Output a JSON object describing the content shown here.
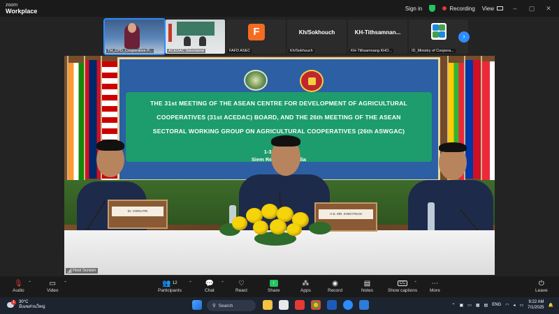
{
  "app": {
    "logo_line1": "zoom",
    "logo_line2": "Workplace"
  },
  "titlebar": {
    "signin": "Sign in",
    "recording": "Recording",
    "view": "View"
  },
  "thumbnails": [
    {
      "name": "TH_CPD_Cooperative P...",
      "type": "video"
    },
    {
      "name": "ACEDAC Sekretariat",
      "type": "video"
    },
    {
      "name": "FAFD ASEC",
      "type": "avatar",
      "initial": "F"
    },
    {
      "name": "Kh/Sokhouch",
      "type": "name",
      "display": "Kh/Sokhouch"
    },
    {
      "name": "KH-Tithsamnang KHO...",
      "type": "name",
      "display": "KH-Tithsamnan..."
    },
    {
      "name": "ID_Ministry of Coopera...",
      "type": "logo"
    }
  ],
  "stage": {
    "banner_line1": "THE 31st MEETING OF THE ASEAN CENTRE FOR DEVELOPMENT OF AGRICULTURAL",
    "banner_line2": "COOPERATIVES (31st ACEDAC) BOARD, AND THE 26th MEETING OF THE ASEAN",
    "banner_line3": "SECTORAL WORKING GROUP ON AGRICULTURAL COOPERATIVES (26th ASWGAC)",
    "banner_date": "1-3 Jul   2025",
    "banner_place": "Siem Reap P        ambodia",
    "plate_left": "Dr. VORN PRI",
    "plate_center": "H.E. MR. KHIM FINAN",
    "host_label": "Host Screen"
  },
  "toolbar": {
    "audio": "Audio",
    "video": "Video",
    "participants": "Participants",
    "participants_count": "12",
    "chat": "Chat",
    "react": "React",
    "share": "Share",
    "apps": "Apps",
    "record": "Record",
    "notes": "Notes",
    "captions": "Show captions",
    "more": "More",
    "leave": "Leave"
  },
  "taskbar": {
    "temp": "30°C",
    "weather": "มีเมฆส่วนใหญ่",
    "search": "Search",
    "lang": "ENG",
    "time": "9:22 AM",
    "date": "7/1/2025"
  },
  "colors": {
    "accent": "#2d8cff",
    "record": "#e53935",
    "share": "#22c55e"
  }
}
